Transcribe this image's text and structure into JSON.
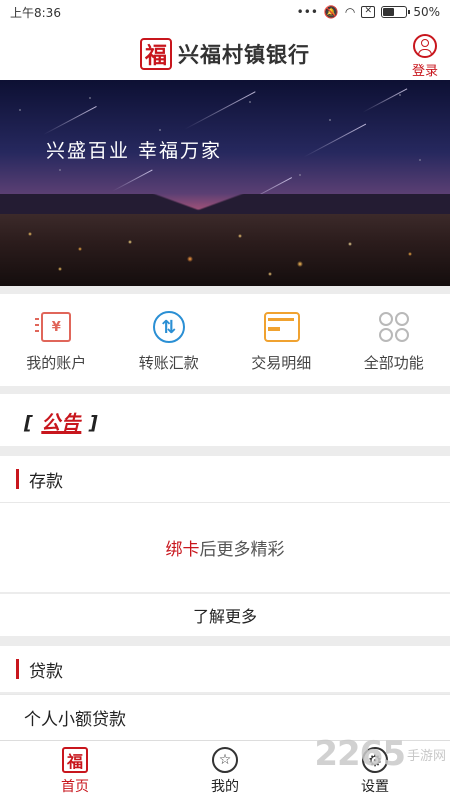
{
  "status_bar": {
    "time": "上午8:36",
    "battery": "50%",
    "signal_icons": [
      "more-icon",
      "mute-icon",
      "wifi-icon",
      "sim-icon"
    ],
    "battery_level": 0.5
  },
  "header": {
    "brand_logo_char": "福",
    "brand_name": "兴福村镇银行",
    "login_label": "登录"
  },
  "banner": {
    "slogan": "兴盛百业 幸福万家"
  },
  "quick_actions": [
    {
      "label": "我的账户",
      "icon": "account-icon",
      "icon_char": "¥",
      "color": "#e0665a"
    },
    {
      "label": "转账汇款",
      "icon": "transfer-icon",
      "icon_char": "⇅",
      "color": "#2a8fd4"
    },
    {
      "label": "交易明细",
      "icon": "transaction-detail-icon",
      "color": "#f0a230"
    },
    {
      "label": "全部功能",
      "icon": "all-functions-icon",
      "color": "#b9b9b9"
    }
  ],
  "notice": {
    "bracket_open": "[",
    "label": "公告",
    "bracket_close": "]"
  },
  "deposit": {
    "title": "存款",
    "prompt_link": "绑卡",
    "prompt_rest": "后更多精彩",
    "learn_more": "了解更多"
  },
  "loan": {
    "title": "贷款",
    "item": "个人小额贷款"
  },
  "tabbar": {
    "items": [
      {
        "label": "首页",
        "icon": "home-icon",
        "icon_char": "福",
        "active": true
      },
      {
        "label": "我的",
        "icon": "mine-icon",
        "icon_char": "☆",
        "active": false
      },
      {
        "label": "设置",
        "icon": "settings-icon",
        "icon_char": "⚙",
        "active": false
      }
    ]
  },
  "watermark": {
    "number": "2265",
    "text": "手游网"
  },
  "colors": {
    "brand_red": "#c8161d"
  }
}
